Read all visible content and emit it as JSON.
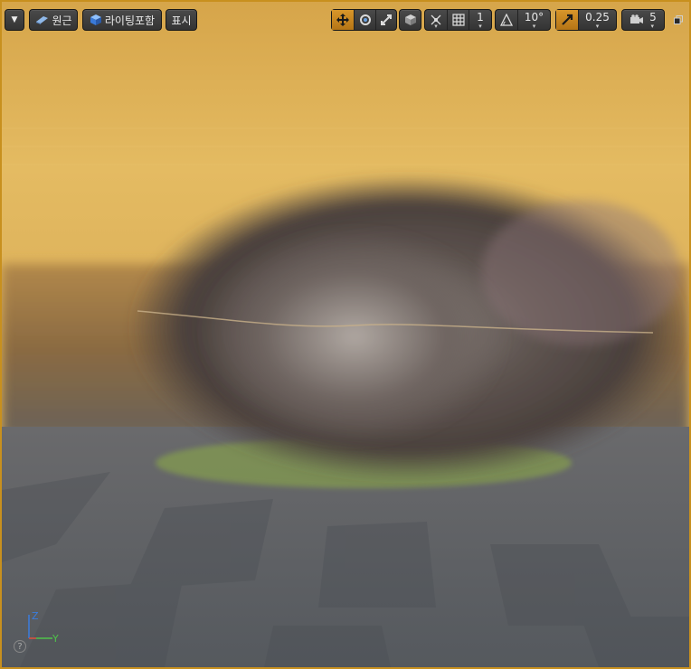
{
  "toolbar": {
    "viewport_options": {
      "icon": "dropdown-arrow-icon"
    },
    "perspective": {
      "label": "원근",
      "icon": "perspective-icon"
    },
    "view_mode": {
      "label": "라이팅포함",
      "icon": "lit-cube-icon"
    },
    "show": {
      "label": "표시"
    },
    "transform_tools": {
      "translate": "move-icon",
      "rotate": "rotate-icon",
      "scale": "scale-icon",
      "active": "translate"
    },
    "world_local": {
      "icon": "world-cube-icon"
    },
    "surface_snap": {
      "icon": "surface-snap-icon"
    },
    "grid_snap": {
      "icon": "grid-icon",
      "value": "1"
    },
    "rotation_snap": {
      "icon": "angle-icon",
      "value": "10°"
    },
    "scale_snap": {
      "icon": "scale-snap-icon",
      "value": "0.25",
      "active": true
    },
    "camera_speed": {
      "icon": "camera-icon",
      "value": "5"
    },
    "maximize": {
      "icon": "maximize-icon"
    }
  },
  "axis_gizmo": {
    "z": "Z",
    "y": "Y",
    "z_color": "#3a7dde",
    "y_color": "#4fc24a",
    "x_color": "#e04040"
  },
  "colors": {
    "accent": "#c8901e",
    "sky": "#e0b65a",
    "floor": "#5a6068"
  }
}
